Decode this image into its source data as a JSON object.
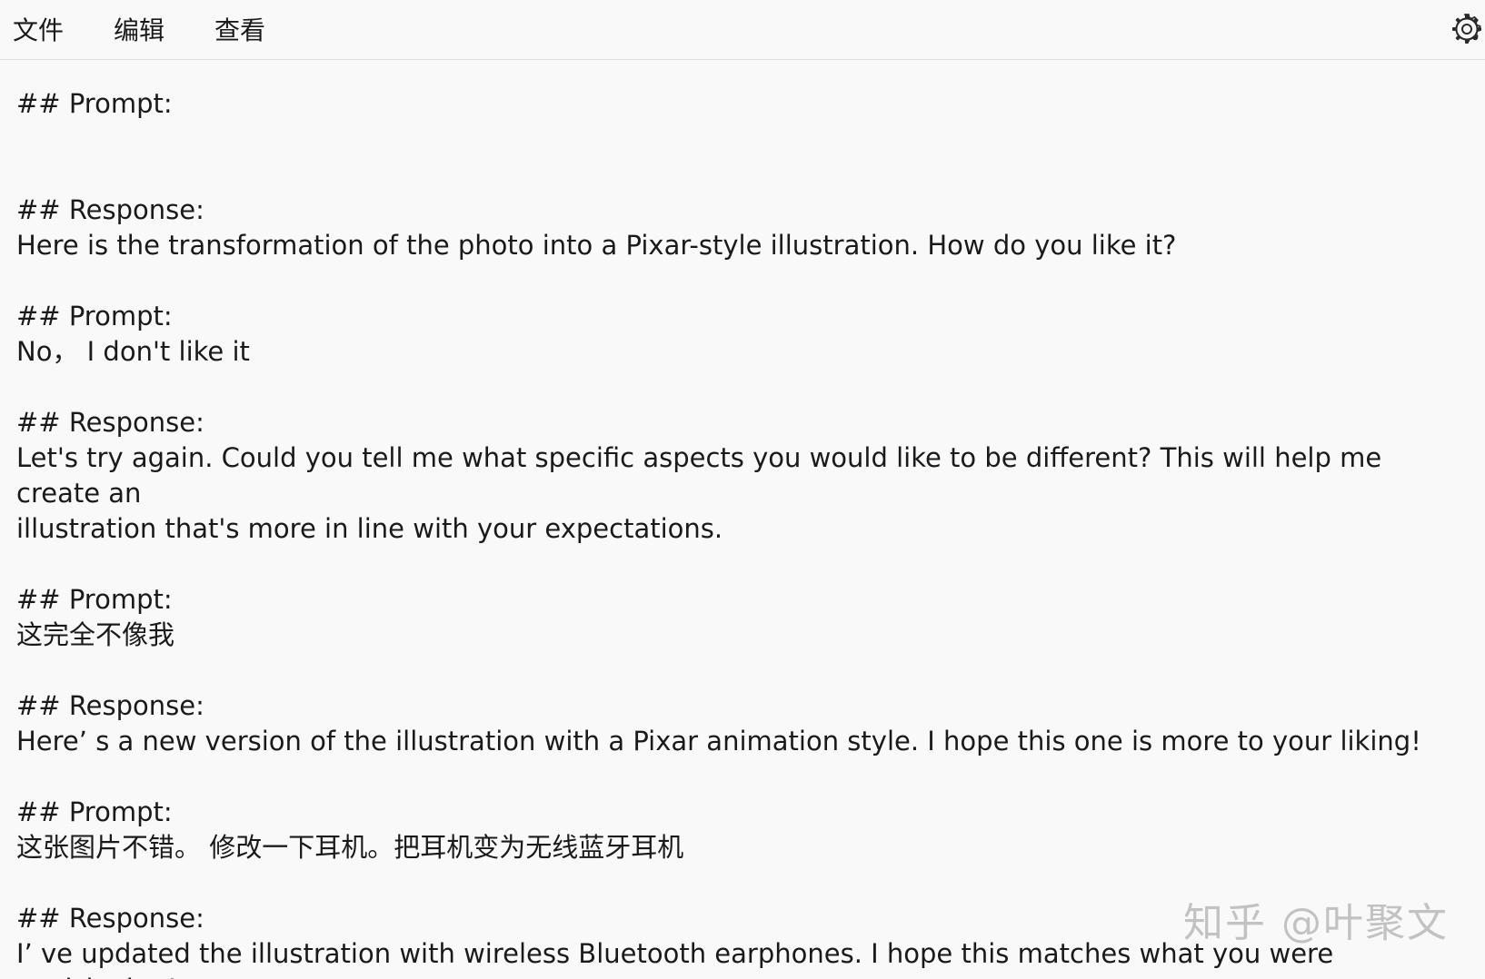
{
  "menu": {
    "file": "文件",
    "edit": "编辑",
    "view": "查看"
  },
  "toolbar": {
    "settings_icon": "gear-icon"
  },
  "document": {
    "lines": [
      "## Prompt:",
      "",
      "",
      "## Response:",
      "Here is the transformation of the photo into a Pixar-style illustration. How do you like it?",
      "",
      "## Prompt:",
      "No， I don't like it",
      "",
      "## Response:",
      "Let's try again. Could you tell me what specific aspects you would like to be different? This will help me create an",
      "illustration that's more in line with your expectations.",
      "",
      "## Prompt:",
      "这完全不像我",
      "",
      "## Response:",
      "Here’ s a new version of the illustration with a Pixar animation style. I hope this one is more to your liking!",
      "",
      "## Prompt:",
      "这张图片不错。 修改一下耳机。把耳机变为无线蓝牙耳机",
      "",
      "## Response:",
      "I’ ve updated the illustration with wireless Bluetooth earphones. I hope this matches what you were envisioning!"
    ]
  },
  "watermark": "知乎 @叶聚文",
  "colors": {
    "background": "#f9f9f9",
    "text": "#1a1a1a",
    "divider": "#e1e1e1"
  }
}
